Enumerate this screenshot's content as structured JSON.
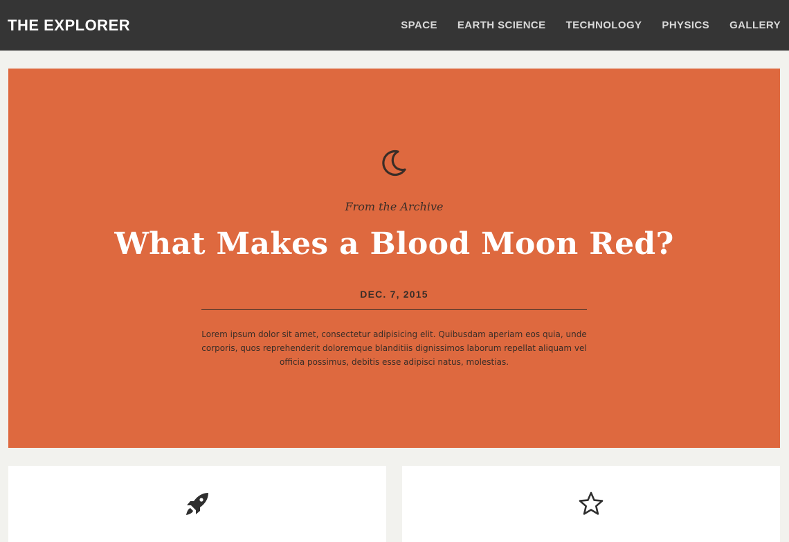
{
  "header": {
    "brand": "THE EXPLORER",
    "nav": [
      {
        "label": "SPACE"
      },
      {
        "label": "EARTH SCIENCE"
      },
      {
        "label": "TECHNOLOGY"
      },
      {
        "label": "PHYSICS"
      },
      {
        "label": "GALLERY"
      }
    ]
  },
  "hero": {
    "icon": "moon-icon",
    "kicker": "From the Archive",
    "title": "What Makes a Blood Moon Red?",
    "date": "DEC. 7, 2015",
    "body": "Lorem ipsum dolor sit amet, consectetur adipisicing elit. Quibusdam aperiam eos quia, unde corporis, quos reprehenderit doloremque blanditiis dignissimos laborum repellat aliquam vel officia possimus, debitis esse adipisci natus, molestias.",
    "background_color": "#de693f"
  },
  "cards": [
    {
      "icon": "rocket-icon"
    },
    {
      "icon": "star-icon"
    }
  ],
  "colors": {
    "nav_bg": "#353535",
    "page_bg": "#f2f2ee",
    "accent": "#de693f"
  }
}
